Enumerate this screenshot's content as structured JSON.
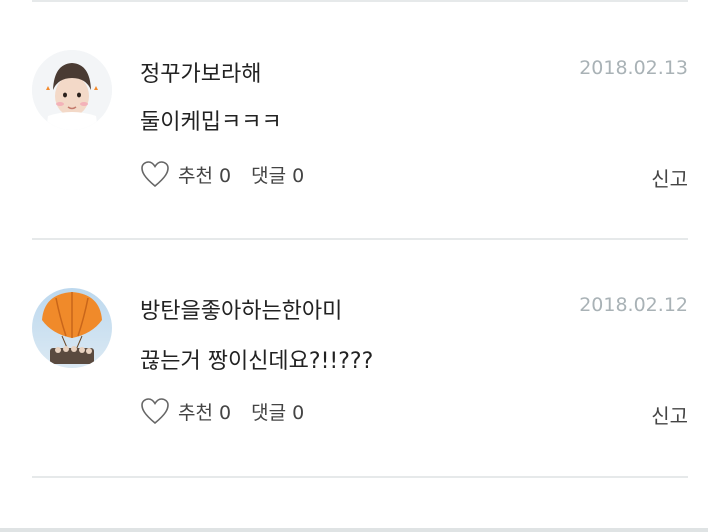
{
  "comments": [
    {
      "author": "정꾸가보라해",
      "date": "2018.02.13",
      "text": "둘이케밉ㅋㅋㅋ",
      "like_label": "추천 0",
      "reply_label": "댓글 0",
      "report_label": "신고",
      "avatar_icon": "avatar-boy-with-bunny-ears"
    },
    {
      "author": "방탄을좋아하는한아미",
      "date": "2018.02.12",
      "text": "끊는거 짱이신데요?!!???",
      "like_label": "추천 0",
      "reply_label": "댓글 0",
      "report_label": "신고",
      "avatar_icon": "avatar-hot-air-balloon"
    }
  ],
  "colors": {
    "date": "#a9b2b6",
    "divider": "#e6e9ea",
    "text": "#222222"
  }
}
